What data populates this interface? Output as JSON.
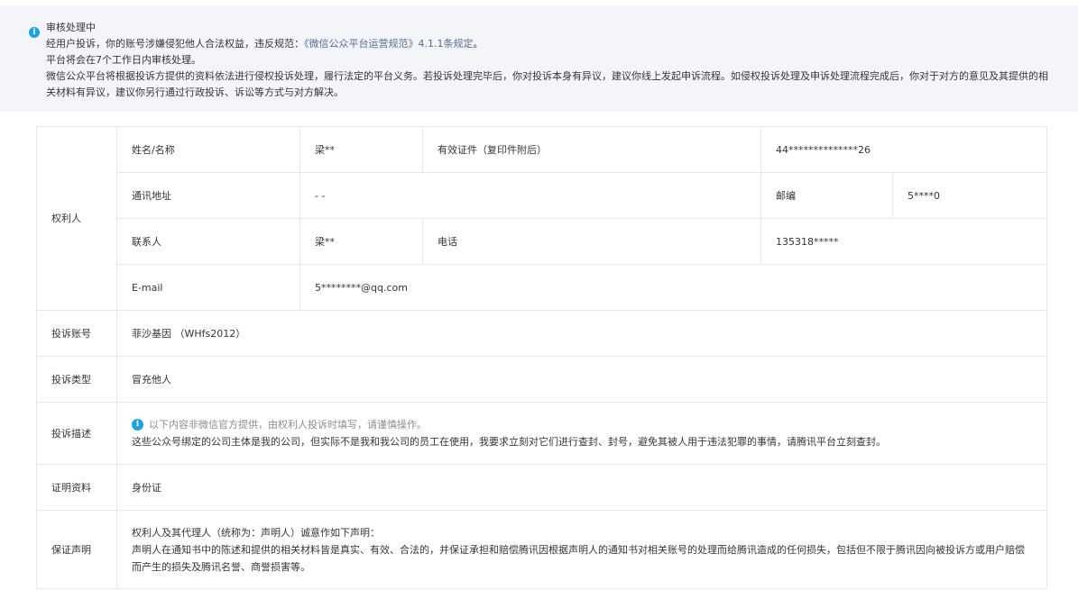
{
  "notice": {
    "icon": "info-icon",
    "title": "审核处理中",
    "line1_prefix": "经用户投诉，你的账号涉嫌侵犯他人合法权益，违反规范：",
    "line1_link": "《微信公众平台运营规范》4.1.1条规定",
    "line1_suffix": "。",
    "line2": "平台将会在7个工作日内审核处理。",
    "line3": "微信公众平台将根据投诉方提供的资料依法进行侵权投诉处理，履行法定的平台义务。若投诉处理完毕后，你对投诉本身有异议，建议你线上发起申诉流程。如侵权投诉处理及申诉处理流程完成后，你对于对方的意见及其提供的相关材料有异议，建议你另行通过行政投诉、诉讼等方式与对方解决。"
  },
  "rights_holder": {
    "label": "权利人",
    "name_label": "姓名/名称",
    "name_value": "梁**",
    "id_label": "有效证件（复印件附后）",
    "id_value": "44**************26",
    "address_label": "通讯地址",
    "address_value": "- -",
    "postcode_label": "邮编",
    "postcode_value": "5****0",
    "contact_label": "联系人",
    "contact_value": "梁**",
    "phone_label": "电话",
    "phone_value": "135318*****",
    "email_label": "E-mail",
    "email_value": "5********@qq.com"
  },
  "complaint_account": {
    "label": "投诉账号",
    "value": "菲沙基因 （WHfs2012）"
  },
  "complaint_type": {
    "label": "投诉类型",
    "value": "冒充他人"
  },
  "complaint_desc": {
    "label": "投诉描述",
    "tip": "以下内容非微信官方提供，由权利人投诉时填写，请谨慎操作。",
    "text": "这些公众号绑定的公司主体是我的公司，但实际不是我和我公司的员工在使用，我要求立刻对它们进行查封、封号，避免其被人用于违法犯罪的事情，请腾讯平台立刻查封。"
  },
  "evidence": {
    "label": "证明资料",
    "value": "身份证"
  },
  "guarantee": {
    "label": "保证声明",
    "line1": "权利人及其代理人（统称为：声明人）诚意作如下声明：",
    "line2": "声明人在通知书中的陈述和提供的相关材料皆是真实、有效、合法的，并保证承担和赔偿腾讯因根据声明人的通知书对相关账号的处理而给腾讯造成的任何损失，包括但不限于腾讯因向被投诉方或用户赔偿而产生的损失及腾讯名誉、商誉损害等。"
  },
  "colors": {
    "link": "#576b95",
    "info": "#1aa2e6",
    "notice_bg": "#f4f5f9",
    "border": "#e7e7eb"
  }
}
